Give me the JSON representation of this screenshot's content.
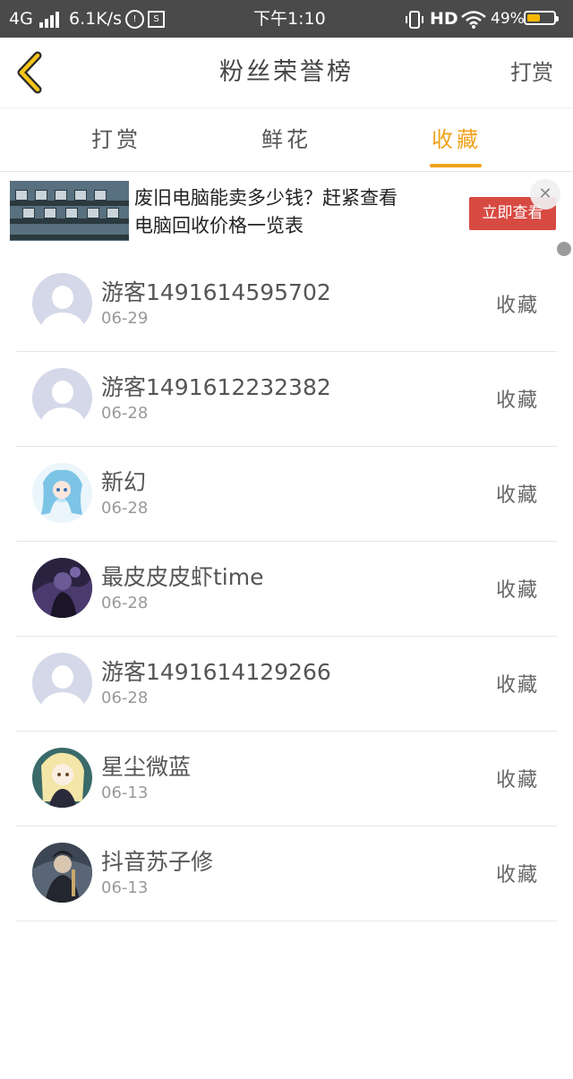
{
  "status_bar": {
    "network": "4G",
    "speed": "6.1K/s",
    "time": "下午1:10",
    "hd": "HD",
    "battery_text": "49%",
    "battery_level": 0.49,
    "battery_color": "#f5b800"
  },
  "header": {
    "title": "粉丝荣誉榜",
    "action": "打赏",
    "back_icon": "chevron-left-icon"
  },
  "tabs": [
    {
      "label": "打赏",
      "active": false
    },
    {
      "label": "鲜花",
      "active": false
    },
    {
      "label": "收藏",
      "active": true
    }
  ],
  "accent_color": "#f0a21b",
  "ad": {
    "text_line1": "废旧电脑能卖多少钱？赶紧查看",
    "text_line2": "电脑回收价格一览表",
    "cta": "立即查看",
    "close": "✕"
  },
  "list": [
    {
      "name": "游客1491614595702",
      "date": "06-29",
      "type": "收藏",
      "avatar": "default"
    },
    {
      "name": "游客1491612232382",
      "date": "06-28",
      "type": "收藏",
      "avatar": "default"
    },
    {
      "name": "新幻",
      "date": "06-28",
      "type": "收藏",
      "avatar": "anime-blue"
    },
    {
      "name": "最皮皮皮虾time",
      "date": "06-28",
      "type": "收藏",
      "avatar": "dark-purple"
    },
    {
      "name": "游客1491614129266",
      "date": "06-28",
      "type": "收藏",
      "avatar": "default"
    },
    {
      "name": "星尘微蓝",
      "date": "06-13",
      "type": "收藏",
      "avatar": "anime-blonde"
    },
    {
      "name": "抖音苏子修",
      "date": "06-13",
      "type": "收藏",
      "avatar": "dark-warrior"
    }
  ]
}
